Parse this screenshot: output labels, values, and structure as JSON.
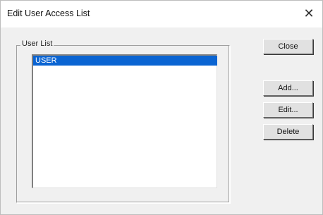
{
  "window": {
    "title": "Edit User Access List",
    "close_glyph": "✕"
  },
  "group": {
    "label": "User List"
  },
  "list": {
    "items": [
      {
        "label": "USER",
        "selected": true
      }
    ]
  },
  "buttons": {
    "close": "Close",
    "add": "Add...",
    "edit": "Edit...",
    "delete": "Delete"
  },
  "colors": {
    "selection": "#0a64d2",
    "dialog_background": "#f0f0f0"
  }
}
